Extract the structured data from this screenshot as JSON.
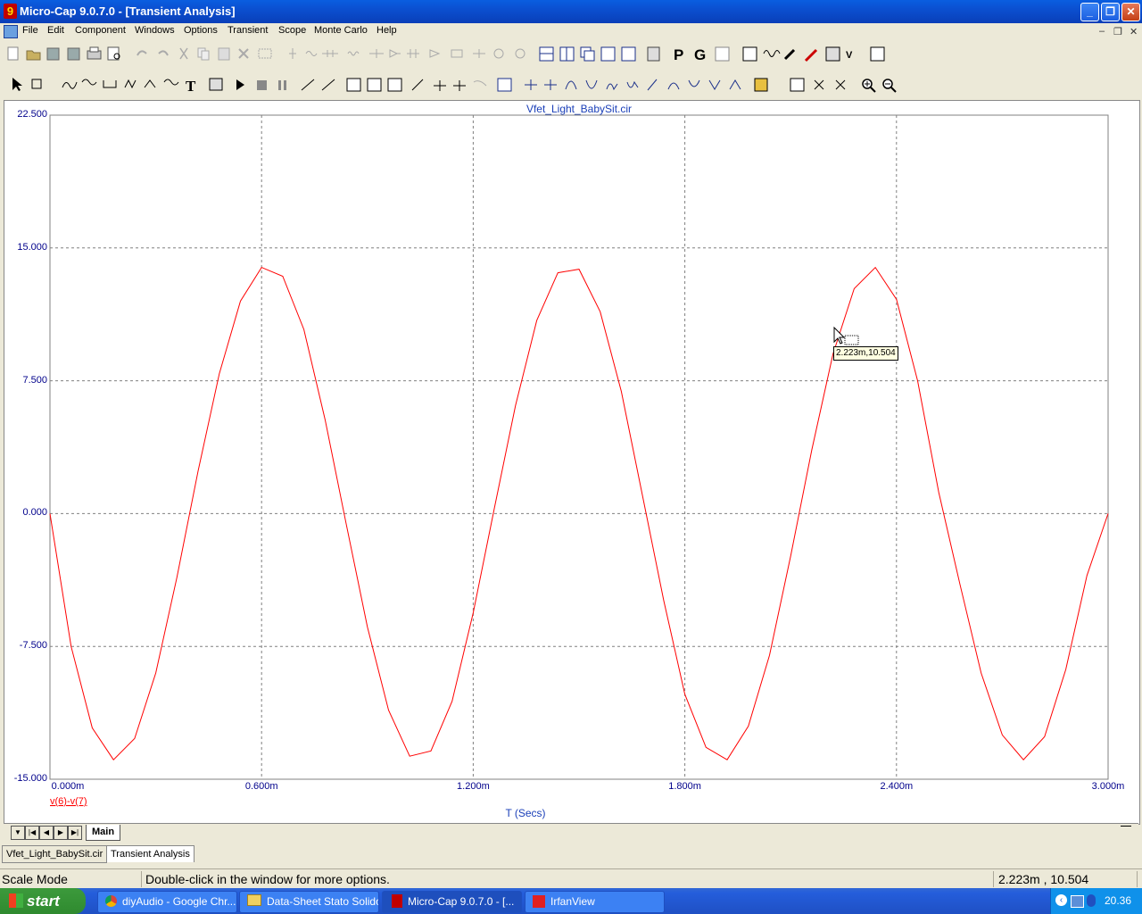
{
  "window": {
    "title": "Micro-Cap 9.0.7.0 - [Transient Analysis]",
    "app_icon_glyph": "9"
  },
  "menu": [
    "File",
    "Edit",
    "Component",
    "Windows",
    "Options",
    "Transient",
    "Scope",
    "Monte Carlo",
    "Help"
  ],
  "plot": {
    "title": "Vfet_Light_BabySit.cir",
    "y_ticks": [
      "22.500",
      "15.000",
      "7.500",
      "0.000",
      "-7.500",
      "-15.000"
    ],
    "x_ticks": [
      "0.000m",
      "0.600m",
      "1.200m",
      "1.800m",
      "2.400m",
      "3.000m"
    ],
    "x_label": "T (Secs)",
    "trace_label": "v(6)-v(7)",
    "trace_color": "#ff0000",
    "grid_color": "#808080",
    "axis_text_color": "#00008b",
    "cursor_readout": "2.223m,10.504"
  },
  "chart_data": {
    "type": "line",
    "title": "Vfet_Light_BabySit.cir",
    "xlabel": "T (Secs)",
    "ylabel": "",
    "xlim": [
      0,
      0.003
    ],
    "ylim": [
      -15,
      22.5
    ],
    "grid": true,
    "series": [
      {
        "name": "v(6)-v(7)",
        "x": [
          0,
          6e-05,
          0.00012,
          0.00018,
          0.00024,
          0.0003,
          0.00036,
          0.00042,
          0.00048,
          0.00054,
          0.0006,
          0.00066,
          0.00072,
          0.00078,
          0.00084,
          0.0009,
          0.00096,
          0.00102,
          0.00108,
          0.00114,
          0.0012,
          0.00126,
          0.00132,
          0.00138,
          0.00144,
          0.0015,
          0.00156,
          0.00162,
          0.00168,
          0.00174,
          0.0018,
          0.00186,
          0.00192,
          0.00198,
          0.00204,
          0.0021,
          0.00216,
          0.00222,
          0.00228,
          0.00234,
          0.0024,
          0.00246,
          0.00252,
          0.00258,
          0.00264,
          0.0027,
          0.00276,
          0.00282,
          0.00288,
          0.00294,
          0.003
        ],
        "y": [
          0,
          -7.5,
          -12.1,
          -13.9,
          -12.7,
          -9.0,
          -3.6,
          2.4,
          7.9,
          12.0,
          13.9,
          13.4,
          10.4,
          5.3,
          -0.6,
          -6.4,
          -11.1,
          -13.7,
          -13.4,
          -10.6,
          -5.6,
          0.3,
          6.1,
          10.9,
          13.6,
          13.8,
          11.4,
          6.9,
          1.0,
          -4.9,
          -10.2,
          -13.2,
          -13.9,
          -12.0,
          -8.0,
          -2.4,
          3.6,
          9.0,
          12.7,
          13.9,
          12.1,
          7.5,
          1.2,
          -4.0,
          -9.0,
          -12.5,
          -13.9,
          -12.6,
          -8.8,
          -3.5,
          0
        ]
      }
    ]
  },
  "sheet_tabs": {
    "main": "Main"
  },
  "doc_tabs": [
    "Vfet_Light_BabySit.cir",
    "Transient Analysis"
  ],
  "status": {
    "mode": "Scale Mode",
    "hint": "Double-click in the window for more options.",
    "coords": "2.223m , 10.504"
  },
  "taskbar": {
    "start": "start",
    "tasks": [
      "diyAudio - Google Chr...",
      "Data-Sheet Stato Solido",
      "Micro-Cap 9.0.7.0 - [...",
      "IrfanView"
    ],
    "clock": "20.36"
  }
}
